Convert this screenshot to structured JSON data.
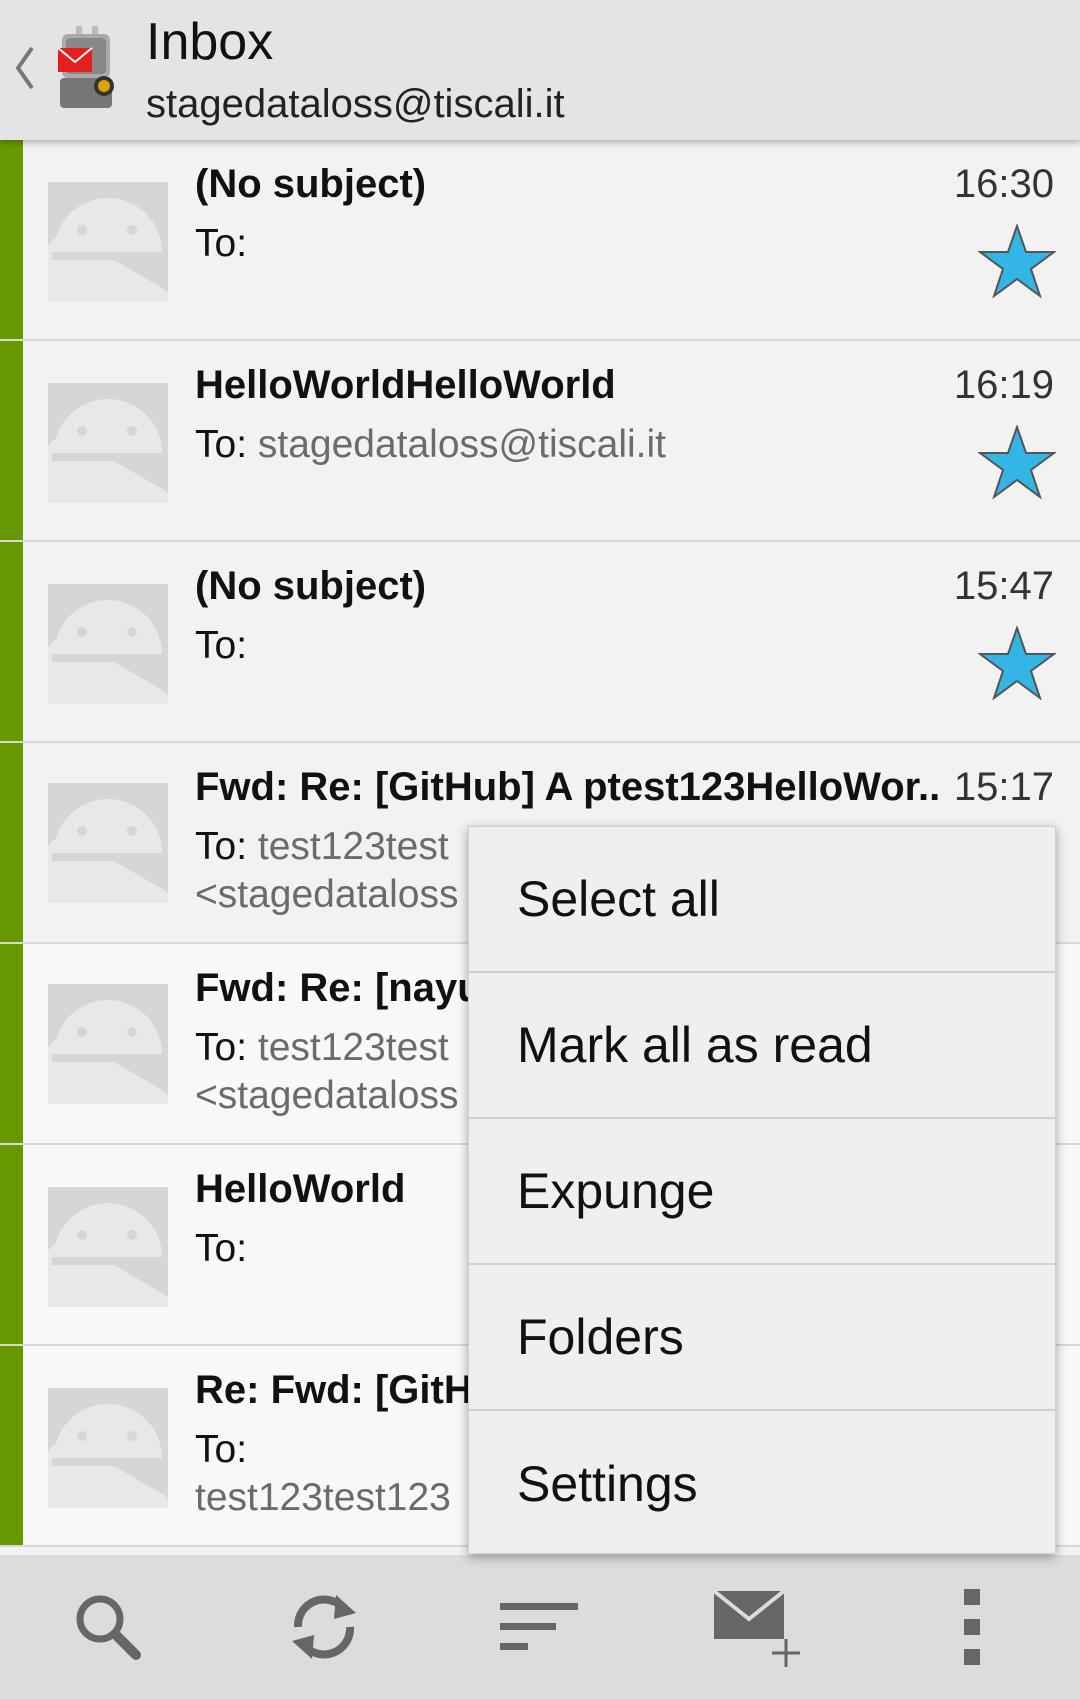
{
  "action_bar": {
    "title": "Inbox",
    "subtitle": "stagedataloss@tiscali.it",
    "up_icon": "chevron-left-icon",
    "app_icon": "k9-mail-robot-icon"
  },
  "messages": [
    {
      "subject": "(No subject)",
      "to_label": "To:",
      "to_value": "",
      "to_value2": "",
      "time": "16:30",
      "starred": true,
      "unread": true
    },
    {
      "subject": "HelloWorldHelloWorld",
      "to_label": "To:",
      "to_value": "stagedataloss@tiscali.it",
      "to_value2": "",
      "time": "16:19",
      "starred": true,
      "unread": true
    },
    {
      "subject": "(No subject)",
      "to_label": "To:",
      "to_value": "",
      "to_value2": "",
      "time": "15:47",
      "starred": true,
      "unread": true
    },
    {
      "subject": "Fwd: Re: [GitHub] A ptest123HelloWor..",
      "to_label": "To:",
      "to_value": "test123test",
      "to_value2": "<stagedataloss",
      "time": "15:17",
      "starred": false,
      "unread": true
    },
    {
      "subject": "Fwd: Re: [nayu",
      "to_label": "To:",
      "to_value": "test123test",
      "to_value2": "<stagedataloss",
      "time": "",
      "starred": false,
      "unread": true
    },
    {
      "subject": "HelloWorld",
      "to_label": "To:",
      "to_value": "",
      "to_value2": "",
      "time": "",
      "starred": false,
      "unread": true
    },
    {
      "subject": "Re: Fwd: [GitHu",
      "to_label": "To:",
      "to_value": "",
      "to_value2": "test123test123",
      "time": "",
      "starred": false,
      "unread": true
    }
  ],
  "overflow_menu": {
    "items": [
      "Select all",
      "Mark all as read",
      "Expunge",
      "Folders",
      "Settings"
    ]
  },
  "toolbar": {
    "icons": [
      "search-icon",
      "refresh-icon",
      "sort-icon",
      "compose-icon",
      "overflow-icon"
    ]
  },
  "colors": {
    "unread_bar": "#669900",
    "star": "#33b5e5",
    "action_bar": "#e4e4e4",
    "toolbar": "#dcdcdc"
  }
}
